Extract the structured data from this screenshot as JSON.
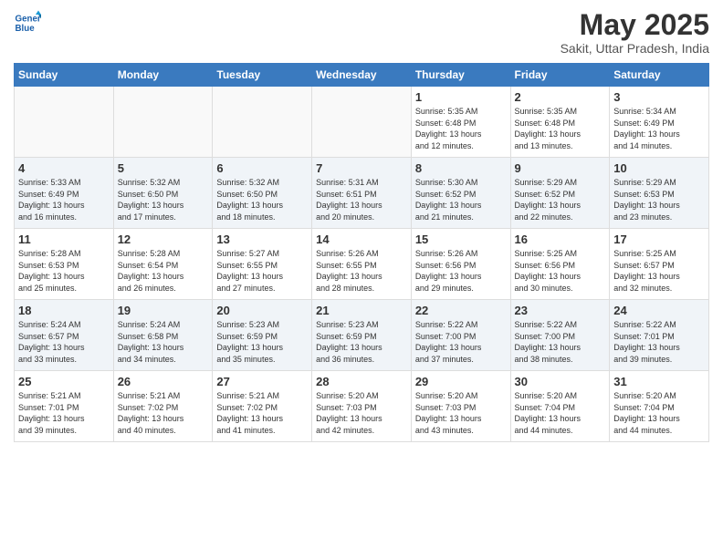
{
  "header": {
    "logo_line1": "General",
    "logo_line2": "Blue",
    "title": "May 2025",
    "subtitle": "Sakit, Uttar Pradesh, India"
  },
  "days_of_week": [
    "Sunday",
    "Monday",
    "Tuesday",
    "Wednesday",
    "Thursday",
    "Friday",
    "Saturday"
  ],
  "weeks": [
    [
      {
        "day": "",
        "content": ""
      },
      {
        "day": "",
        "content": ""
      },
      {
        "day": "",
        "content": ""
      },
      {
        "day": "",
        "content": ""
      },
      {
        "day": "1",
        "content": "Sunrise: 5:35 AM\nSunset: 6:48 PM\nDaylight: 13 hours\nand 12 minutes."
      },
      {
        "day": "2",
        "content": "Sunrise: 5:35 AM\nSunset: 6:48 PM\nDaylight: 13 hours\nand 13 minutes."
      },
      {
        "day": "3",
        "content": "Sunrise: 5:34 AM\nSunset: 6:49 PM\nDaylight: 13 hours\nand 14 minutes."
      }
    ],
    [
      {
        "day": "4",
        "content": "Sunrise: 5:33 AM\nSunset: 6:49 PM\nDaylight: 13 hours\nand 16 minutes."
      },
      {
        "day": "5",
        "content": "Sunrise: 5:32 AM\nSunset: 6:50 PM\nDaylight: 13 hours\nand 17 minutes."
      },
      {
        "day": "6",
        "content": "Sunrise: 5:32 AM\nSunset: 6:50 PM\nDaylight: 13 hours\nand 18 minutes."
      },
      {
        "day": "7",
        "content": "Sunrise: 5:31 AM\nSunset: 6:51 PM\nDaylight: 13 hours\nand 20 minutes."
      },
      {
        "day": "8",
        "content": "Sunrise: 5:30 AM\nSunset: 6:52 PM\nDaylight: 13 hours\nand 21 minutes."
      },
      {
        "day": "9",
        "content": "Sunrise: 5:29 AM\nSunset: 6:52 PM\nDaylight: 13 hours\nand 22 minutes."
      },
      {
        "day": "10",
        "content": "Sunrise: 5:29 AM\nSunset: 6:53 PM\nDaylight: 13 hours\nand 23 minutes."
      }
    ],
    [
      {
        "day": "11",
        "content": "Sunrise: 5:28 AM\nSunset: 6:53 PM\nDaylight: 13 hours\nand 25 minutes."
      },
      {
        "day": "12",
        "content": "Sunrise: 5:28 AM\nSunset: 6:54 PM\nDaylight: 13 hours\nand 26 minutes."
      },
      {
        "day": "13",
        "content": "Sunrise: 5:27 AM\nSunset: 6:55 PM\nDaylight: 13 hours\nand 27 minutes."
      },
      {
        "day": "14",
        "content": "Sunrise: 5:26 AM\nSunset: 6:55 PM\nDaylight: 13 hours\nand 28 minutes."
      },
      {
        "day": "15",
        "content": "Sunrise: 5:26 AM\nSunset: 6:56 PM\nDaylight: 13 hours\nand 29 minutes."
      },
      {
        "day": "16",
        "content": "Sunrise: 5:25 AM\nSunset: 6:56 PM\nDaylight: 13 hours\nand 30 minutes."
      },
      {
        "day": "17",
        "content": "Sunrise: 5:25 AM\nSunset: 6:57 PM\nDaylight: 13 hours\nand 32 minutes."
      }
    ],
    [
      {
        "day": "18",
        "content": "Sunrise: 5:24 AM\nSunset: 6:57 PM\nDaylight: 13 hours\nand 33 minutes."
      },
      {
        "day": "19",
        "content": "Sunrise: 5:24 AM\nSunset: 6:58 PM\nDaylight: 13 hours\nand 34 minutes."
      },
      {
        "day": "20",
        "content": "Sunrise: 5:23 AM\nSunset: 6:59 PM\nDaylight: 13 hours\nand 35 minutes."
      },
      {
        "day": "21",
        "content": "Sunrise: 5:23 AM\nSunset: 6:59 PM\nDaylight: 13 hours\nand 36 minutes."
      },
      {
        "day": "22",
        "content": "Sunrise: 5:22 AM\nSunset: 7:00 PM\nDaylight: 13 hours\nand 37 minutes."
      },
      {
        "day": "23",
        "content": "Sunrise: 5:22 AM\nSunset: 7:00 PM\nDaylight: 13 hours\nand 38 minutes."
      },
      {
        "day": "24",
        "content": "Sunrise: 5:22 AM\nSunset: 7:01 PM\nDaylight: 13 hours\nand 39 minutes."
      }
    ],
    [
      {
        "day": "25",
        "content": "Sunrise: 5:21 AM\nSunset: 7:01 PM\nDaylight: 13 hours\nand 39 minutes."
      },
      {
        "day": "26",
        "content": "Sunrise: 5:21 AM\nSunset: 7:02 PM\nDaylight: 13 hours\nand 40 minutes."
      },
      {
        "day": "27",
        "content": "Sunrise: 5:21 AM\nSunset: 7:02 PM\nDaylight: 13 hours\nand 41 minutes."
      },
      {
        "day": "28",
        "content": "Sunrise: 5:20 AM\nSunset: 7:03 PM\nDaylight: 13 hours\nand 42 minutes."
      },
      {
        "day": "29",
        "content": "Sunrise: 5:20 AM\nSunset: 7:03 PM\nDaylight: 13 hours\nand 43 minutes."
      },
      {
        "day": "30",
        "content": "Sunrise: 5:20 AM\nSunset: 7:04 PM\nDaylight: 13 hours\nand 44 minutes."
      },
      {
        "day": "31",
        "content": "Sunrise: 5:20 AM\nSunset: 7:04 PM\nDaylight: 13 hours\nand 44 minutes."
      }
    ]
  ]
}
